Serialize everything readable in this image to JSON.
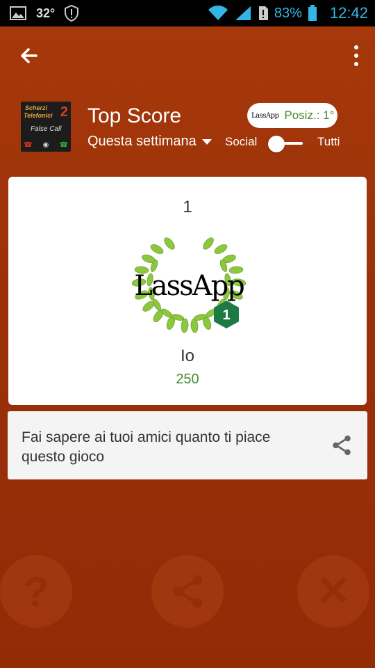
{
  "status_bar": {
    "temperature": "32°",
    "battery": "83%",
    "time": "12:42"
  },
  "app_bar": {
    "back_icon": "arrow-back-icon",
    "menu_icon": "more-vert-icon"
  },
  "header": {
    "title": "Top Score",
    "period": "Questa settimana",
    "rank_logo": "LassApp",
    "rank_label": "Posiz.: 1°",
    "toggle_left": "Social",
    "toggle_right": "Tutti"
  },
  "app_icon": {
    "line1": "Scherzi",
    "line2": "Telefonici",
    "number": "2",
    "line3": "False Call"
  },
  "leader": {
    "position": "1",
    "badge_number": "1",
    "logo_text": "LassApp",
    "name": "Io",
    "score": "250"
  },
  "share": {
    "text": "Fai sapere ai tuoi amici quanto ti piace questo gioco",
    "icon": "share-icon"
  },
  "colors": {
    "background": "#9a2f08",
    "accent_green": "#4a8a2a",
    "badge_green": "#1e7a45",
    "leaf_green": "#8dc63f"
  }
}
